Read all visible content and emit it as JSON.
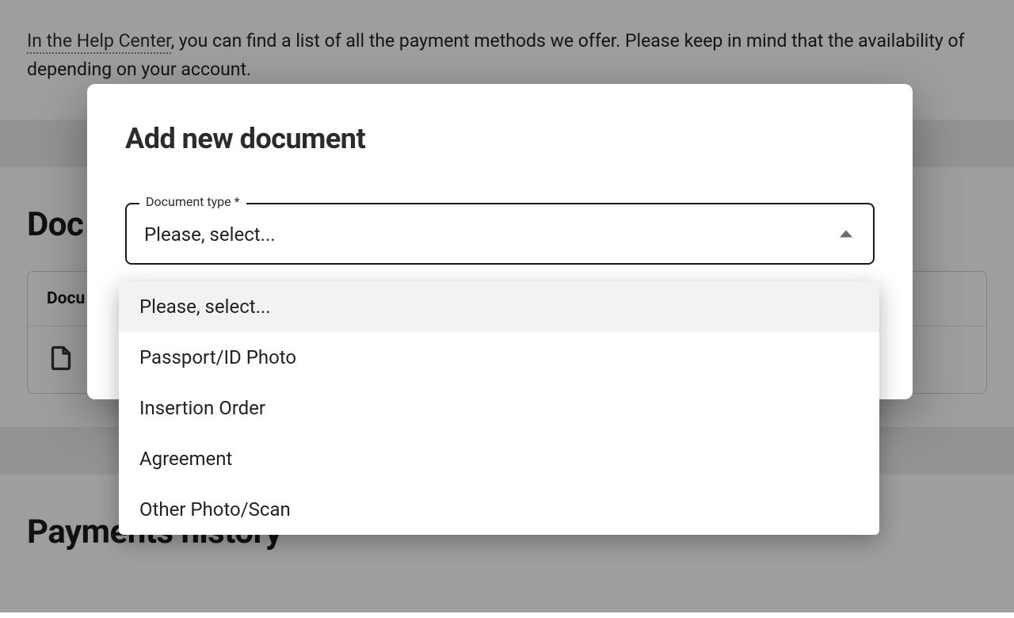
{
  "intro": {
    "link_text": "In the Help Center",
    "rest_line1": ", you can find a list of all the payment methods we offer. Please keep in mind that the availability of",
    "rest_line2": "depending on your account."
  },
  "documents_section_title": "Doc",
  "table_header_col1": "Docu",
  "history_section_title": "Payments history",
  "modal": {
    "title": "Add new document",
    "field_label": "Document type *",
    "placeholder": "Please, select...",
    "options": [
      "Please, select...",
      "Passport/ID Photo",
      "Insertion Order",
      "Agreement",
      "Other Photo/Scan"
    ],
    "selected_index": 0
  }
}
